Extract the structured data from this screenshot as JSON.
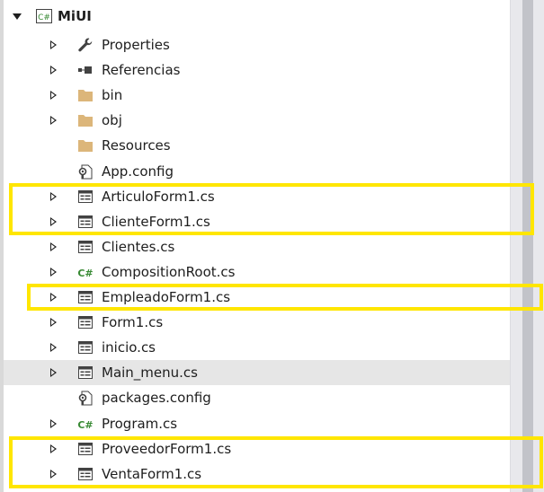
{
  "project": {
    "name": "MiUI",
    "icon": "csharp-project-icon"
  },
  "items": [
    {
      "label": "Properties",
      "icon": "wrench-icon",
      "expandable": true
    },
    {
      "label": "Referencias",
      "icon": "references-icon",
      "expandable": true
    },
    {
      "label": "bin",
      "icon": "folder-icon",
      "expandable": true
    },
    {
      "label": "obj",
      "icon": "folder-icon",
      "expandable": true
    },
    {
      "label": "Resources",
      "icon": "folder-icon",
      "expandable": false
    },
    {
      "label": "App.config",
      "icon": "config-file-icon",
      "expandable": false
    },
    {
      "label": "ArticuloForm1.cs",
      "icon": "form-icon",
      "expandable": true
    },
    {
      "label": "ClienteForm1.cs",
      "icon": "form-icon",
      "expandable": true
    },
    {
      "label": "Clientes.cs",
      "icon": "form-icon",
      "expandable": true
    },
    {
      "label": "CompositionRoot.cs",
      "icon": "csharp-file-icon",
      "expandable": true
    },
    {
      "label": "EmpleadoForm1.cs",
      "icon": "form-icon",
      "expandable": true
    },
    {
      "label": "Form1.cs",
      "icon": "form-icon",
      "expandable": true
    },
    {
      "label": "inicio.cs",
      "icon": "form-icon",
      "expandable": true
    },
    {
      "label": "Main_menu.cs",
      "icon": "form-icon",
      "expandable": true,
      "selected": true
    },
    {
      "label": "packages.config",
      "icon": "config-file-icon",
      "expandable": false
    },
    {
      "label": "Program.cs",
      "icon": "csharp-file-icon",
      "expandable": true
    },
    {
      "label": "ProveedorForm1.cs",
      "icon": "form-icon",
      "expandable": true
    },
    {
      "label": "VentaForm1.cs",
      "icon": "form-icon",
      "expandable": true
    }
  ],
  "highlight_color": "#ffe600",
  "selection_color": "#e6e6e6",
  "csharp_badge_color": "#388a34",
  "folder_color": "#dcb67a"
}
